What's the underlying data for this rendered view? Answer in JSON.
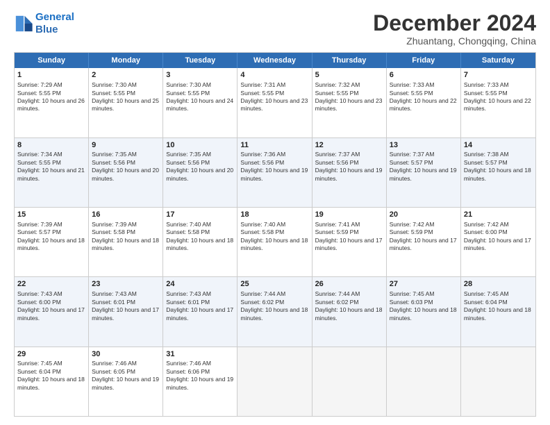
{
  "logo": {
    "line1": "General",
    "line2": "Blue"
  },
  "title": "December 2024",
  "subtitle": "Zhuantang, Chongqing, China",
  "days_of_week": [
    "Sunday",
    "Monday",
    "Tuesday",
    "Wednesday",
    "Thursday",
    "Friday",
    "Saturday"
  ],
  "weeks": [
    [
      {
        "day": "1",
        "sunrise": "Sunrise: 7:29 AM",
        "sunset": "Sunset: 5:55 PM",
        "daylight": "Daylight: 10 hours and 26 minutes."
      },
      {
        "day": "2",
        "sunrise": "Sunrise: 7:30 AM",
        "sunset": "Sunset: 5:55 PM",
        "daylight": "Daylight: 10 hours and 25 minutes."
      },
      {
        "day": "3",
        "sunrise": "Sunrise: 7:30 AM",
        "sunset": "Sunset: 5:55 PM",
        "daylight": "Daylight: 10 hours and 24 minutes."
      },
      {
        "day": "4",
        "sunrise": "Sunrise: 7:31 AM",
        "sunset": "Sunset: 5:55 PM",
        "daylight": "Daylight: 10 hours and 23 minutes."
      },
      {
        "day": "5",
        "sunrise": "Sunrise: 7:32 AM",
        "sunset": "Sunset: 5:55 PM",
        "daylight": "Daylight: 10 hours and 23 minutes."
      },
      {
        "day": "6",
        "sunrise": "Sunrise: 7:33 AM",
        "sunset": "Sunset: 5:55 PM",
        "daylight": "Daylight: 10 hours and 22 minutes."
      },
      {
        "day": "7",
        "sunrise": "Sunrise: 7:33 AM",
        "sunset": "Sunset: 5:55 PM",
        "daylight": "Daylight: 10 hours and 22 minutes."
      }
    ],
    [
      {
        "day": "8",
        "sunrise": "Sunrise: 7:34 AM",
        "sunset": "Sunset: 5:55 PM",
        "daylight": "Daylight: 10 hours and 21 minutes."
      },
      {
        "day": "9",
        "sunrise": "Sunrise: 7:35 AM",
        "sunset": "Sunset: 5:56 PM",
        "daylight": "Daylight: 10 hours and 20 minutes."
      },
      {
        "day": "10",
        "sunrise": "Sunrise: 7:35 AM",
        "sunset": "Sunset: 5:56 PM",
        "daylight": "Daylight: 10 hours and 20 minutes."
      },
      {
        "day": "11",
        "sunrise": "Sunrise: 7:36 AM",
        "sunset": "Sunset: 5:56 PM",
        "daylight": "Daylight: 10 hours and 19 minutes."
      },
      {
        "day": "12",
        "sunrise": "Sunrise: 7:37 AM",
        "sunset": "Sunset: 5:56 PM",
        "daylight": "Daylight: 10 hours and 19 minutes."
      },
      {
        "day": "13",
        "sunrise": "Sunrise: 7:37 AM",
        "sunset": "Sunset: 5:57 PM",
        "daylight": "Daylight: 10 hours and 19 minutes."
      },
      {
        "day": "14",
        "sunrise": "Sunrise: 7:38 AM",
        "sunset": "Sunset: 5:57 PM",
        "daylight": "Daylight: 10 hours and 18 minutes."
      }
    ],
    [
      {
        "day": "15",
        "sunrise": "Sunrise: 7:39 AM",
        "sunset": "Sunset: 5:57 PM",
        "daylight": "Daylight: 10 hours and 18 minutes."
      },
      {
        "day": "16",
        "sunrise": "Sunrise: 7:39 AM",
        "sunset": "Sunset: 5:58 PM",
        "daylight": "Daylight: 10 hours and 18 minutes."
      },
      {
        "day": "17",
        "sunrise": "Sunrise: 7:40 AM",
        "sunset": "Sunset: 5:58 PM",
        "daylight": "Daylight: 10 hours and 18 minutes."
      },
      {
        "day": "18",
        "sunrise": "Sunrise: 7:40 AM",
        "sunset": "Sunset: 5:58 PM",
        "daylight": "Daylight: 10 hours and 18 minutes."
      },
      {
        "day": "19",
        "sunrise": "Sunrise: 7:41 AM",
        "sunset": "Sunset: 5:59 PM",
        "daylight": "Daylight: 10 hours and 17 minutes."
      },
      {
        "day": "20",
        "sunrise": "Sunrise: 7:42 AM",
        "sunset": "Sunset: 5:59 PM",
        "daylight": "Daylight: 10 hours and 17 minutes."
      },
      {
        "day": "21",
        "sunrise": "Sunrise: 7:42 AM",
        "sunset": "Sunset: 6:00 PM",
        "daylight": "Daylight: 10 hours and 17 minutes."
      }
    ],
    [
      {
        "day": "22",
        "sunrise": "Sunrise: 7:43 AM",
        "sunset": "Sunset: 6:00 PM",
        "daylight": "Daylight: 10 hours and 17 minutes."
      },
      {
        "day": "23",
        "sunrise": "Sunrise: 7:43 AM",
        "sunset": "Sunset: 6:01 PM",
        "daylight": "Daylight: 10 hours and 17 minutes."
      },
      {
        "day": "24",
        "sunrise": "Sunrise: 7:43 AM",
        "sunset": "Sunset: 6:01 PM",
        "daylight": "Daylight: 10 hours and 17 minutes."
      },
      {
        "day": "25",
        "sunrise": "Sunrise: 7:44 AM",
        "sunset": "Sunset: 6:02 PM",
        "daylight": "Daylight: 10 hours and 18 minutes."
      },
      {
        "day": "26",
        "sunrise": "Sunrise: 7:44 AM",
        "sunset": "Sunset: 6:02 PM",
        "daylight": "Daylight: 10 hours and 18 minutes."
      },
      {
        "day": "27",
        "sunrise": "Sunrise: 7:45 AM",
        "sunset": "Sunset: 6:03 PM",
        "daylight": "Daylight: 10 hours and 18 minutes."
      },
      {
        "day": "28",
        "sunrise": "Sunrise: 7:45 AM",
        "sunset": "Sunset: 6:04 PM",
        "daylight": "Daylight: 10 hours and 18 minutes."
      }
    ],
    [
      {
        "day": "29",
        "sunrise": "Sunrise: 7:45 AM",
        "sunset": "Sunset: 6:04 PM",
        "daylight": "Daylight: 10 hours and 18 minutes."
      },
      {
        "day": "30",
        "sunrise": "Sunrise: 7:46 AM",
        "sunset": "Sunset: 6:05 PM",
        "daylight": "Daylight: 10 hours and 19 minutes."
      },
      {
        "day": "31",
        "sunrise": "Sunrise: 7:46 AM",
        "sunset": "Sunset: 6:06 PM",
        "daylight": "Daylight: 10 hours and 19 minutes."
      },
      {
        "day": "",
        "sunrise": "",
        "sunset": "",
        "daylight": ""
      },
      {
        "day": "",
        "sunrise": "",
        "sunset": "",
        "daylight": ""
      },
      {
        "day": "",
        "sunrise": "",
        "sunset": "",
        "daylight": ""
      },
      {
        "day": "",
        "sunrise": "",
        "sunset": "",
        "daylight": ""
      }
    ]
  ]
}
